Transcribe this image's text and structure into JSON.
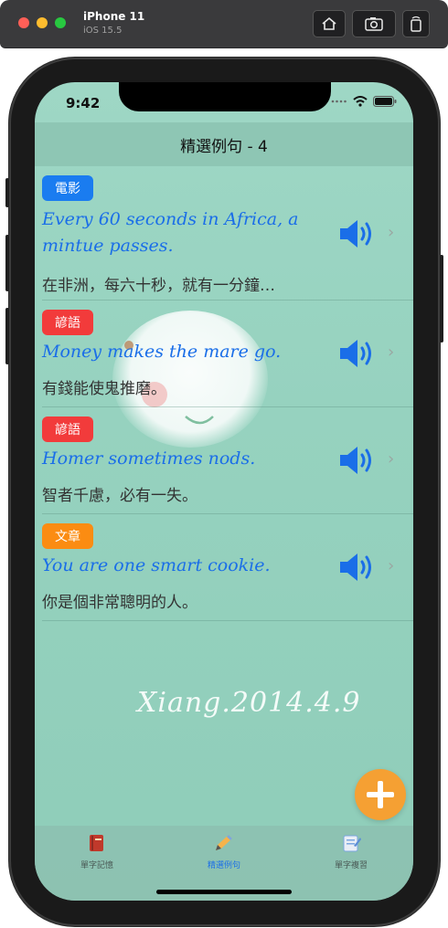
{
  "window": {
    "device_name": "iPhone 11",
    "os_version": "iOS 15.5",
    "toolbar": [
      "home-icon",
      "screenshot-icon",
      "rotate-icon"
    ]
  },
  "status_bar": {
    "time": "9:42"
  },
  "nav": {
    "title": "精選例句 - 4"
  },
  "sentences": [
    {
      "tag": "電影",
      "tag_color": "#1a7cf0",
      "english": "Every 60 seconds in Africa, a mintue passes.",
      "chinese": "在非洲，每六十秒，就有一分鐘…"
    },
    {
      "tag": "諺語",
      "tag_color": "#f23b3b",
      "english": "Money makes the mare go.",
      "chinese": "有錢能使鬼推磨。"
    },
    {
      "tag": "諺語",
      "tag_color": "#f23b3b",
      "english": "Homer sometimes nods.",
      "chinese": "智者千慮，必有一失。"
    },
    {
      "tag": "文章",
      "tag_color": "#fb8c12",
      "english": "You are one smart cookie.",
      "chinese": "你是個非常聰明的人。"
    }
  ],
  "background_signature": "Xiang.2014.4.9",
  "fab": {
    "icon": "plus-icon"
  },
  "tabbar": {
    "items": [
      {
        "label": "單字記憶",
        "icon": "book-icon",
        "active": false
      },
      {
        "label": "精選例句",
        "icon": "pencil-icon",
        "active": true
      },
      {
        "label": "單字複習",
        "icon": "notepad-icon",
        "active": false
      }
    ]
  },
  "colors": {
    "accent": "#1a6ee8",
    "fab": "#f5a033",
    "screen_bg": "#9ed7c5"
  }
}
